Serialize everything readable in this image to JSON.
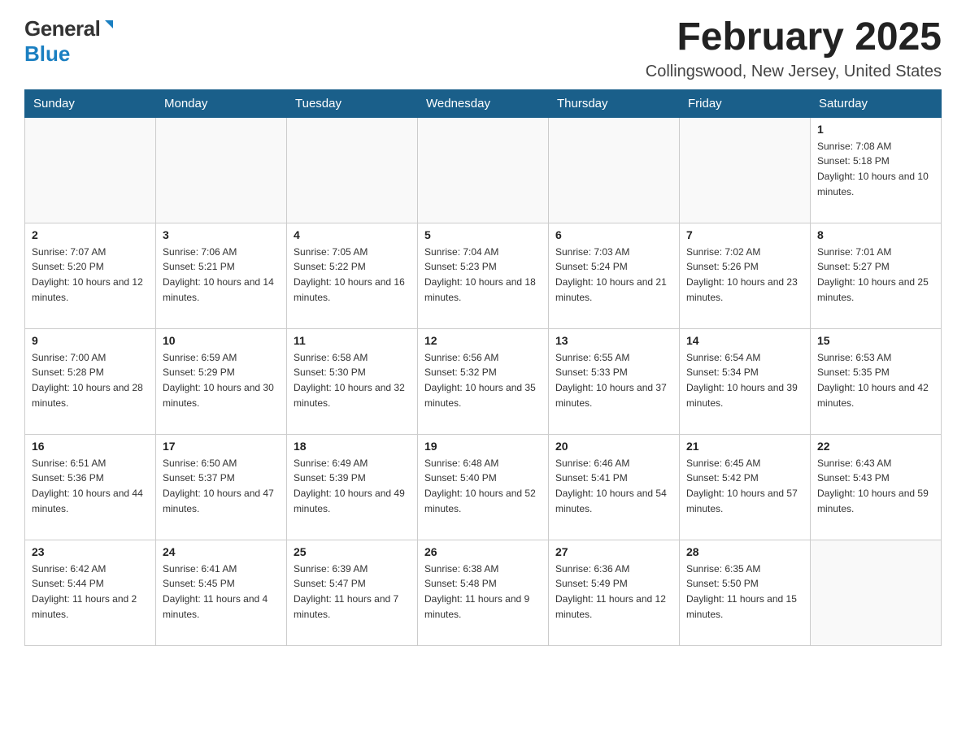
{
  "header": {
    "logo_general": "General",
    "logo_blue": "Blue",
    "month_title": "February 2025",
    "location": "Collingswood, New Jersey, United States"
  },
  "days_of_week": [
    "Sunday",
    "Monday",
    "Tuesday",
    "Wednesday",
    "Thursday",
    "Friday",
    "Saturday"
  ],
  "weeks": [
    [
      {
        "day": "",
        "info": ""
      },
      {
        "day": "",
        "info": ""
      },
      {
        "day": "",
        "info": ""
      },
      {
        "day": "",
        "info": ""
      },
      {
        "day": "",
        "info": ""
      },
      {
        "day": "",
        "info": ""
      },
      {
        "day": "1",
        "info": "Sunrise: 7:08 AM\nSunset: 5:18 PM\nDaylight: 10 hours and 10 minutes."
      }
    ],
    [
      {
        "day": "2",
        "info": "Sunrise: 7:07 AM\nSunset: 5:20 PM\nDaylight: 10 hours and 12 minutes."
      },
      {
        "day": "3",
        "info": "Sunrise: 7:06 AM\nSunset: 5:21 PM\nDaylight: 10 hours and 14 minutes."
      },
      {
        "day": "4",
        "info": "Sunrise: 7:05 AM\nSunset: 5:22 PM\nDaylight: 10 hours and 16 minutes."
      },
      {
        "day": "5",
        "info": "Sunrise: 7:04 AM\nSunset: 5:23 PM\nDaylight: 10 hours and 18 minutes."
      },
      {
        "day": "6",
        "info": "Sunrise: 7:03 AM\nSunset: 5:24 PM\nDaylight: 10 hours and 21 minutes."
      },
      {
        "day": "7",
        "info": "Sunrise: 7:02 AM\nSunset: 5:26 PM\nDaylight: 10 hours and 23 minutes."
      },
      {
        "day": "8",
        "info": "Sunrise: 7:01 AM\nSunset: 5:27 PM\nDaylight: 10 hours and 25 minutes."
      }
    ],
    [
      {
        "day": "9",
        "info": "Sunrise: 7:00 AM\nSunset: 5:28 PM\nDaylight: 10 hours and 28 minutes."
      },
      {
        "day": "10",
        "info": "Sunrise: 6:59 AM\nSunset: 5:29 PM\nDaylight: 10 hours and 30 minutes."
      },
      {
        "day": "11",
        "info": "Sunrise: 6:58 AM\nSunset: 5:30 PM\nDaylight: 10 hours and 32 minutes."
      },
      {
        "day": "12",
        "info": "Sunrise: 6:56 AM\nSunset: 5:32 PM\nDaylight: 10 hours and 35 minutes."
      },
      {
        "day": "13",
        "info": "Sunrise: 6:55 AM\nSunset: 5:33 PM\nDaylight: 10 hours and 37 minutes."
      },
      {
        "day": "14",
        "info": "Sunrise: 6:54 AM\nSunset: 5:34 PM\nDaylight: 10 hours and 39 minutes."
      },
      {
        "day": "15",
        "info": "Sunrise: 6:53 AM\nSunset: 5:35 PM\nDaylight: 10 hours and 42 minutes."
      }
    ],
    [
      {
        "day": "16",
        "info": "Sunrise: 6:51 AM\nSunset: 5:36 PM\nDaylight: 10 hours and 44 minutes."
      },
      {
        "day": "17",
        "info": "Sunrise: 6:50 AM\nSunset: 5:37 PM\nDaylight: 10 hours and 47 minutes."
      },
      {
        "day": "18",
        "info": "Sunrise: 6:49 AM\nSunset: 5:39 PM\nDaylight: 10 hours and 49 minutes."
      },
      {
        "day": "19",
        "info": "Sunrise: 6:48 AM\nSunset: 5:40 PM\nDaylight: 10 hours and 52 minutes."
      },
      {
        "day": "20",
        "info": "Sunrise: 6:46 AM\nSunset: 5:41 PM\nDaylight: 10 hours and 54 minutes."
      },
      {
        "day": "21",
        "info": "Sunrise: 6:45 AM\nSunset: 5:42 PM\nDaylight: 10 hours and 57 minutes."
      },
      {
        "day": "22",
        "info": "Sunrise: 6:43 AM\nSunset: 5:43 PM\nDaylight: 10 hours and 59 minutes."
      }
    ],
    [
      {
        "day": "23",
        "info": "Sunrise: 6:42 AM\nSunset: 5:44 PM\nDaylight: 11 hours and 2 minutes."
      },
      {
        "day": "24",
        "info": "Sunrise: 6:41 AM\nSunset: 5:45 PM\nDaylight: 11 hours and 4 minutes."
      },
      {
        "day": "25",
        "info": "Sunrise: 6:39 AM\nSunset: 5:47 PM\nDaylight: 11 hours and 7 minutes."
      },
      {
        "day": "26",
        "info": "Sunrise: 6:38 AM\nSunset: 5:48 PM\nDaylight: 11 hours and 9 minutes."
      },
      {
        "day": "27",
        "info": "Sunrise: 6:36 AM\nSunset: 5:49 PM\nDaylight: 11 hours and 12 minutes."
      },
      {
        "day": "28",
        "info": "Sunrise: 6:35 AM\nSunset: 5:50 PM\nDaylight: 11 hours and 15 minutes."
      },
      {
        "day": "",
        "info": ""
      }
    ]
  ]
}
